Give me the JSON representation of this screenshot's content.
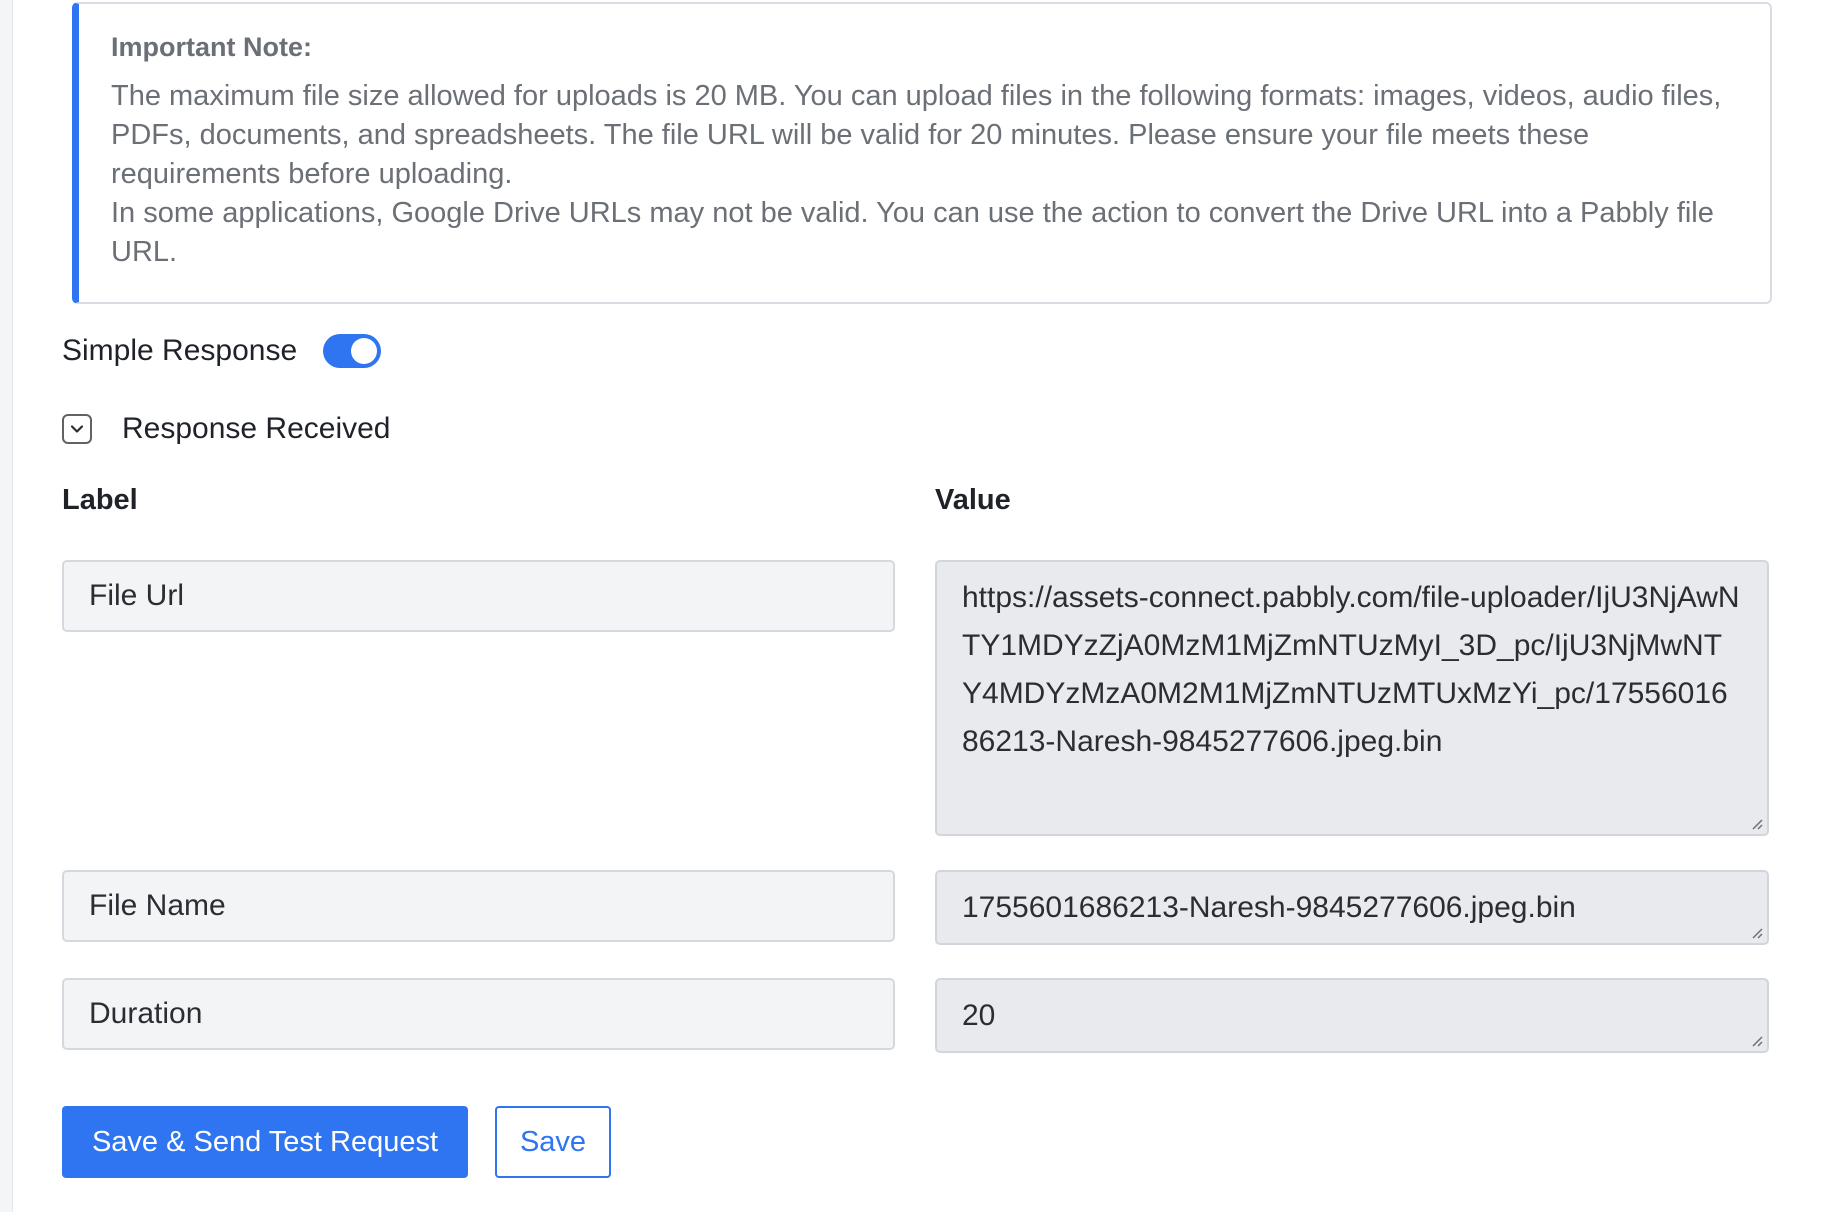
{
  "note": {
    "title": "Important Note:",
    "paragraph1": "The maximum file size allowed for uploads is 20 MB. You can upload files in the following formats: images, videos, audio files, PDFs, documents, and spreadsheets. The file URL will be valid for 20 minutes. Please ensure your file meets these requirements before uploading.",
    "paragraph2": "In some applications, Google Drive URLs may not be valid. You can use the action to convert the Drive URL into a Pabbly file URL."
  },
  "simple_response": {
    "label": "Simple Response",
    "enabled": true
  },
  "response_section": {
    "title": "Response Received",
    "icon": "chevron-down-icon"
  },
  "table": {
    "label_header": "Label",
    "value_header": "Value",
    "rows": [
      {
        "label": "File Url",
        "value": "https://assets-connect.pabbly.com/file-uploader/IjU3NjAwNTY1MDYzZjA0MzM1MjZmNTUzMyI_3D_pc/IjU3NjMwNTY4MDYzMzA0M2M1MjZmNTUzMTUxMzYi_pc/1755601686213-Naresh-9845277606.jpeg.bin"
      },
      {
        "label": "File Name",
        "value": "1755601686213-Naresh-9845277606.jpeg.bin"
      },
      {
        "label": "Duration",
        "value": "20"
      }
    ]
  },
  "buttons": {
    "save_and_send": "Save & Send Test Request",
    "save": "Save"
  },
  "colors": {
    "accent": "#2f74f0",
    "note_text": "#6b6f76",
    "value_bg": "#e9eaed",
    "label_bg": "#f3f4f6"
  }
}
